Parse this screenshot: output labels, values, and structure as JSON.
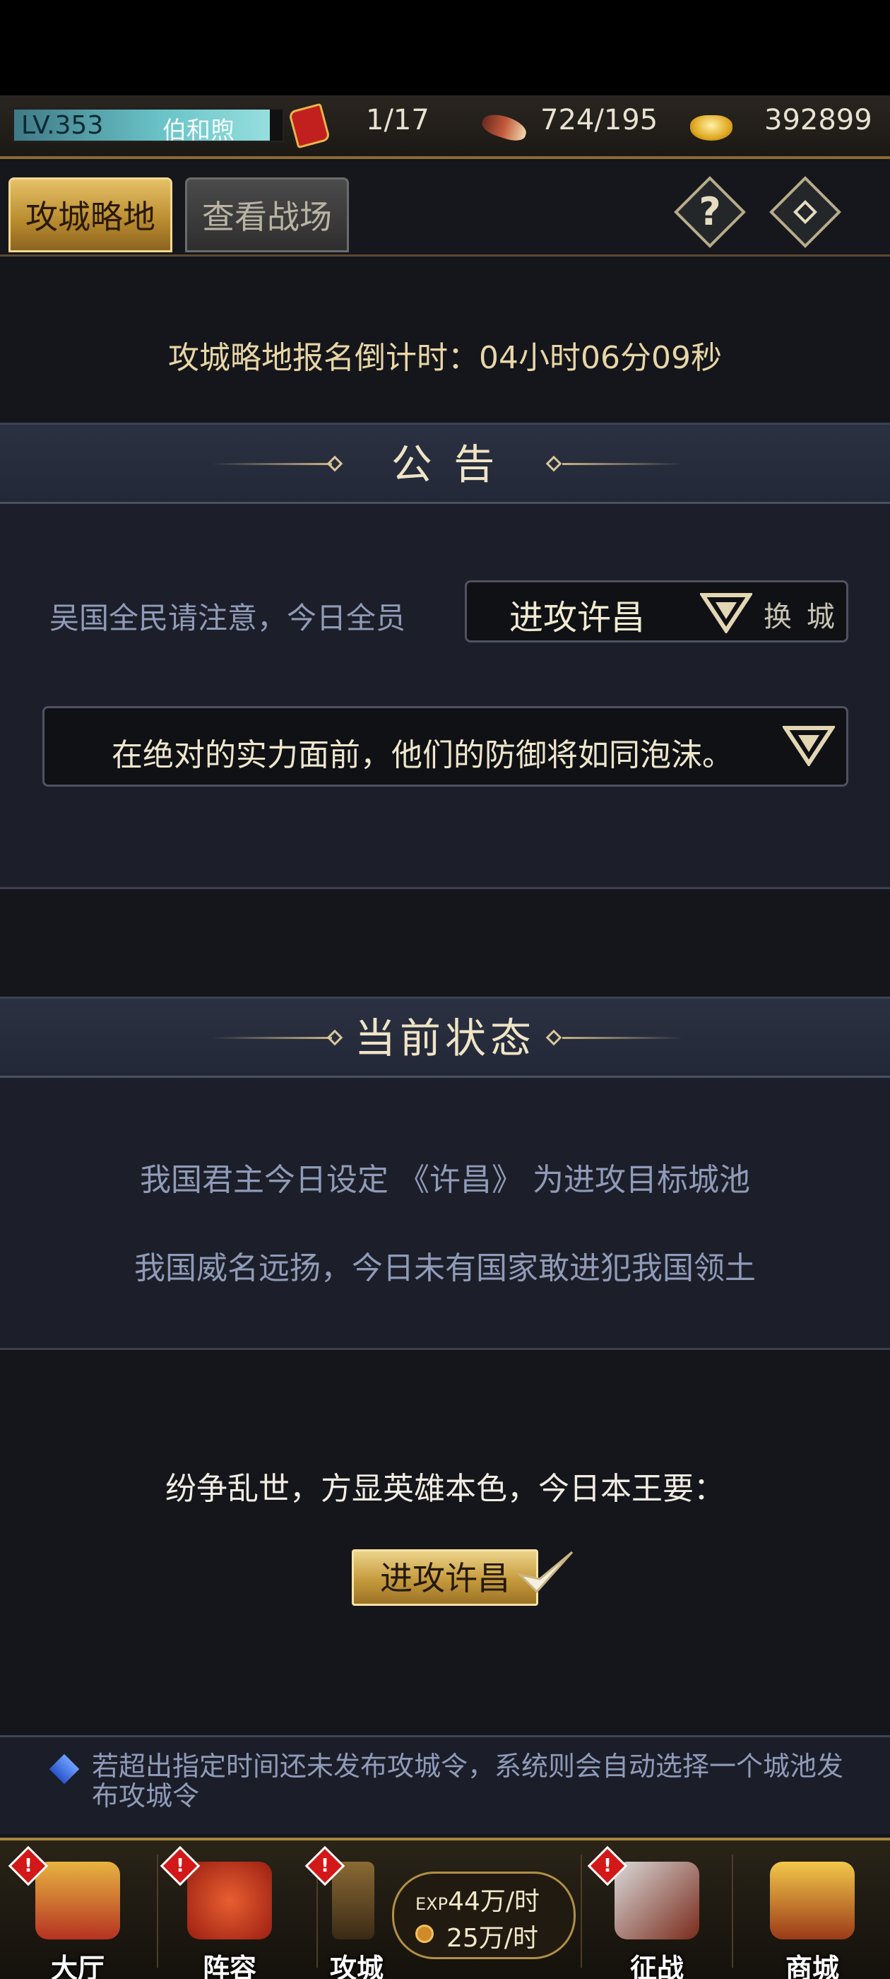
{
  "header": {
    "level": "LV.353",
    "player_name": "伯和煦",
    "resources": [
      {
        "icon": "red-token-icon",
        "value": "1/17"
      },
      {
        "icon": "horn-icon",
        "value": "724/195"
      },
      {
        "icon": "gold-ingot-icon",
        "value": "392899"
      }
    ]
  },
  "tabs": [
    {
      "label": "攻城略地",
      "active": true
    },
    {
      "label": "查看战场",
      "active": false
    }
  ],
  "toolbar": {
    "help_glyph": "?",
    "accent": "#c9b583"
  },
  "countdown": "攻城略地报名倒计时：04小时06分09秒",
  "notice": {
    "title": "公 告",
    "prefix": "吴国全民请注意，今日全员",
    "city_value": "进攻许昌",
    "swap_label": "换 城",
    "slogan": "在绝对的实力面前，他们的防御将如同泡沫。"
  },
  "status": {
    "title": "当前状态",
    "line1": "我国君主今日设定 《许昌》 为进攻目标城池",
    "line2": "我国威名远扬，今日未有国家敢进犯我国领土"
  },
  "declaration": "纷争乱世，方显英雄本色，今日本王要：",
  "attack_button": "进攻许昌",
  "tip": "若超出指定时间还未发布攻城令，系统则会自动选择一个城池发布攻城令",
  "bottom_nav": {
    "alert_glyph": "!",
    "items": [
      {
        "label": "大厅",
        "icon": "hall-icon",
        "alert": true
      },
      {
        "label": "阵容",
        "icon": "team-banner-icon",
        "alert": true
      },
      {
        "label": "攻城",
        "icon": "hourglass-icon",
        "alert": true
      },
      {
        "label": "征战",
        "icon": "sword-icon",
        "alert": true
      },
      {
        "label": "商城",
        "icon": "treasure-chest-icon",
        "alert": false
      }
    ],
    "exp_rate": "44万/时",
    "exp_prefix": "EXP",
    "coin_rate": "25万/时"
  }
}
